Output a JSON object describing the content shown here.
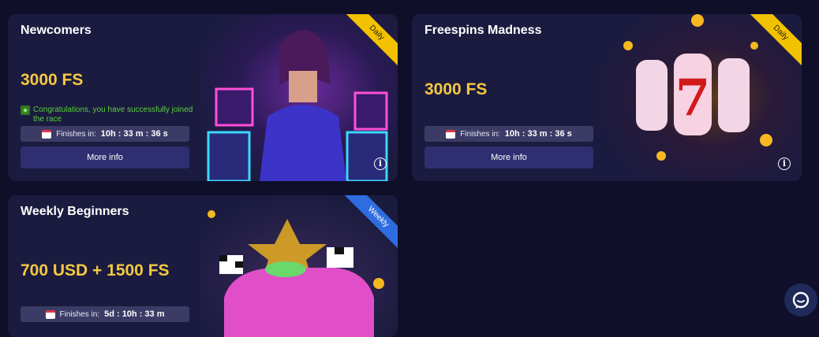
{
  "cards": [
    {
      "title": "Newcomers",
      "prize": "3000 FS",
      "congrats": "Congratulations, you have successfully joined the race",
      "timer_label": "Finishes in:",
      "timer_value": "10h : 33 m : 36 s",
      "button": "More info",
      "ribbon": "Daily"
    },
    {
      "title": "Freespins Madness",
      "prize": "3000 FS",
      "timer_label": "Finishes in:",
      "timer_value": "10h : 33 m : 36 s",
      "button": "More info",
      "ribbon": "Daily"
    },
    {
      "title": "Weekly Beginners",
      "prize": "700 USD + 1500 FS",
      "timer_label": "Finishes in:",
      "timer_value": "5d : 10h : 33 m",
      "ribbon": "Weekly"
    }
  ],
  "icons": {
    "info": "i",
    "chat": "chat-bubble-icon",
    "calendar": "calendar-icon",
    "trophy": "trophy-icon"
  },
  "colors": {
    "background": "#0f0f2a",
    "card": "#1b1b3f",
    "prize": "#f5c842",
    "success": "#57d13f",
    "daily_ribbon": "#f2c200",
    "weekly_ribbon": "#2e6de0",
    "button": "#2e2e70"
  }
}
